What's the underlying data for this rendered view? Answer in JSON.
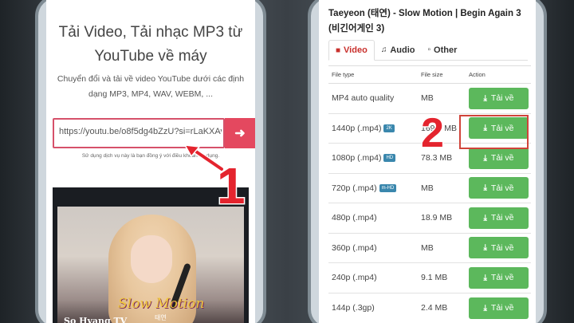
{
  "left_screen": {
    "title": "Tải Video, Tải nhạc MP3 từ YouTube về máy",
    "subtitle": "Chuyển đổi và tải về video YouTube dưới các định dạng MP3, MP4, WAV, WEBM, ...",
    "url_value": "https://youtu.be/o8f5dg4bZzU?si=rLaKXAv",
    "submit_icon": "arrow-right-icon",
    "terms_text": "Sử dụng dịch vụ này là bạn đồng ý với điều khoản sử dụng.",
    "video": {
      "overlay_title": "Slow Motion",
      "overlay_artist": "태연",
      "channel": "So Hyang TV"
    }
  },
  "annotations": {
    "step1": "1",
    "step2": "2",
    "accent_color": "#e4242e"
  },
  "right_screen": {
    "title": "Taeyeon (태연) - Slow Motion | Begin Again 3 (비긴어게인 3)",
    "tabs": [
      {
        "label": "Video",
        "icon": "video-camera-icon",
        "active": true
      },
      {
        "label": "Audio",
        "icon": "music-note-icon",
        "active": false
      },
      {
        "label": "Other",
        "icon": "file-icon",
        "active": false
      }
    ],
    "columns": [
      "File type",
      "File size",
      "Action"
    ],
    "download_label": "Tải về",
    "rows": [
      {
        "type": "MP4 auto quality",
        "badge": "",
        "size": "MB"
      },
      {
        "type": "1440p (.mp4)",
        "badge": "2K",
        "size": "169.6 MB"
      },
      {
        "type": "1080p (.mp4)",
        "badge": "HD",
        "size": "78.3 MB"
      },
      {
        "type": "720p (.mp4)",
        "badge": "m-HD",
        "size": "MB"
      },
      {
        "type": "480p (.mp4)",
        "badge": "",
        "size": "18.9 MB"
      },
      {
        "type": "360p (.mp4)",
        "badge": "",
        "size": "MB"
      },
      {
        "type": "240p (.mp4)",
        "badge": "",
        "size": "9.1 MB"
      },
      {
        "type": "144p (.3gp)",
        "badge": "",
        "size": "2.4 MB"
      }
    ]
  }
}
